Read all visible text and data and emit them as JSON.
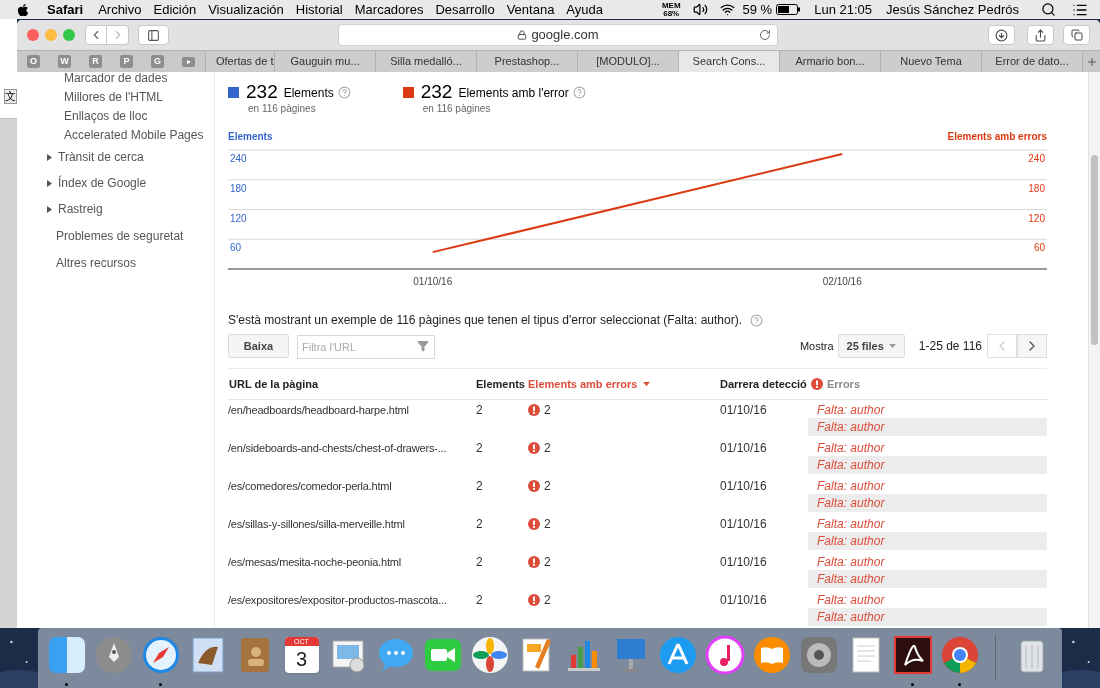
{
  "menu_bar": {
    "app": "Safari",
    "menus": [
      "Archivo",
      "Edición",
      "Visualización",
      "Historial",
      "Marcadores",
      "Desarrollo",
      "Ventana",
      "Ayuda"
    ],
    "memory": {
      "label": "MEM",
      "value": "68%"
    },
    "battery": "59 %",
    "clock": "Lun 21:05",
    "user": "Jesús Sánchez Pedrós"
  },
  "background_window": {
    "glyph": "文"
  },
  "browser": {
    "address": "google.com",
    "favorites": [
      "O",
      "W",
      "R",
      "P",
      "G"
    ],
    "tabs": [
      {
        "label": "Ofertas de t",
        "selected": false
      },
      {
        "label": "Gauguin mu...",
        "selected": false
      },
      {
        "label": "Silla medalló...",
        "selected": false
      },
      {
        "label": "Prestashop...",
        "selected": false
      },
      {
        "label": "[MODULO]...",
        "selected": false
      },
      {
        "label": "Search Cons...",
        "selected": true
      },
      {
        "label": "Armario bon...",
        "selected": false
      },
      {
        "label": "Nuevo Tema",
        "selected": false
      },
      {
        "label": "Error de dato...",
        "selected": false
      }
    ]
  },
  "sidebar": {
    "items": [
      {
        "kind": "sub",
        "label": "Marcador de dades"
      },
      {
        "kind": "sub",
        "label": "Millores de l'HTML"
      },
      {
        "kind": "sub",
        "label": "Enllaços de lloc"
      },
      {
        "kind": "sub",
        "label": "Accelerated Mobile Pages"
      },
      {
        "kind": "section",
        "label": "Trànsit de cerca",
        "expanded": false
      },
      {
        "kind": "section",
        "label": "Índex de Google",
        "expanded": false
      },
      {
        "kind": "section",
        "label": "Rastreig",
        "expanded": false
      },
      {
        "kind": "link",
        "label": "Problemes de seguretat"
      },
      {
        "kind": "link",
        "label": "Altres recursos"
      }
    ]
  },
  "summary": [
    {
      "value": "232",
      "label": "Elements",
      "note": "en 116 pàgines",
      "color": "#3366cc"
    },
    {
      "value": "232",
      "label": "Elements amb l'error",
      "note": "en 116 pàgines",
      "color": "#dc3912"
    }
  ],
  "chart": {
    "right_yticks": [
      "240",
      "180",
      "120",
      "60"
    ],
    "chart_data": {
      "type": "line",
      "ylabel": "Elements",
      "categories": [
        "01/10/16",
        "02/10/16"
      ],
      "series": [
        {
          "name": "Elements amb errors",
          "color": "#dc3912",
          "values": [
            34,
            232
          ]
        }
      ],
      "ylim": [
        0,
        240
      ],
      "grid": true,
      "yticks": [
        {
          "value": 60,
          "label": "60"
        },
        {
          "value": 120,
          "label": "120"
        },
        {
          "value": 180,
          "label": "180"
        },
        {
          "value": 240,
          "label": "240"
        }
      ]
    }
  },
  "sample_text": "S'està mostrant un exemple de 116 pàgines que tenen el tipus d'error seleccionat (Falta: author).",
  "controls": {
    "download_button": "Baixa",
    "filter": {
      "placeholder": "Filtra l'URL"
    },
    "show_label": "Mostra",
    "page_size": "25 files",
    "range": "1-25 de 116",
    "prev": {
      "disabled": true
    },
    "next": {
      "disabled": false
    }
  },
  "table": {
    "columns": [
      {
        "kind": "text",
        "label": "URL de la pàgina",
        "sorted": false
      },
      {
        "kind": "text",
        "label": "Elements",
        "sorted": false
      },
      {
        "kind": "text",
        "label": "Elements amb errors",
        "sorted": true
      },
      {
        "kind": "text",
        "label": "Darrera detecció",
        "sorted": false
      },
      {
        "kind": "errors",
        "label": "Errors",
        "sorted": false
      }
    ],
    "rows": [
      {
        "url": "/en/headboards/headboard-harpe.html",
        "elements": "2",
        "errors": "2",
        "detected": "01/10/16",
        "issues": [
          "Falta: author",
          "Falta: author"
        ]
      },
      {
        "url": "/en/sideboards-and-chests/chest-of-drawers-...",
        "elements": "2",
        "errors": "2",
        "detected": "01/10/16",
        "issues": [
          "Falta: author",
          "Falta: author"
        ]
      },
      {
        "url": "/es/comedores/comedor-perla.html",
        "elements": "2",
        "errors": "2",
        "detected": "01/10/16",
        "issues": [
          "Falta: author",
          "Falta: author"
        ]
      },
      {
        "url": "/es/sillas-y-sillones/silla-merveille.html",
        "elements": "2",
        "errors": "2",
        "detected": "01/10/16",
        "issues": [
          "Falta: author",
          "Falta: author"
        ]
      },
      {
        "url": "/es/mesas/mesita-noche-peonia.html",
        "elements": "2",
        "errors": "2",
        "detected": "01/10/16",
        "issues": [
          "Falta: author",
          "Falta: author"
        ]
      },
      {
        "url": "/es/expositores/expositor-productos-mascota...",
        "elements": "2",
        "errors": "2",
        "detected": "01/10/16",
        "issues": [
          "Falta: author",
          "Falta: author"
        ]
      }
    ]
  },
  "dock": [
    {
      "kind": "finder",
      "running": true
    },
    {
      "kind": "launchpad",
      "running": false
    },
    {
      "kind": "safari",
      "running": true
    },
    {
      "kind": "mail",
      "running": false
    },
    {
      "kind": "contacts",
      "running": false
    },
    {
      "kind": "calendar",
      "running": false,
      "month": "OCT",
      "day": "3"
    },
    {
      "kind": "viewer",
      "running": false
    },
    {
      "kind": "messages",
      "running": false
    },
    {
      "kind": "facetime",
      "running": false
    },
    {
      "kind": "photos",
      "running": false
    },
    {
      "kind": "pages",
      "running": false
    },
    {
      "kind": "numbers",
      "running": false
    },
    {
      "kind": "keynote",
      "running": false
    },
    {
      "kind": "appstore",
      "running": false
    },
    {
      "kind": "music",
      "running": false
    },
    {
      "kind": "books",
      "running": false
    },
    {
      "kind": "settings",
      "running": false
    },
    {
      "kind": "textedit",
      "running": false
    },
    {
      "kind": "acrobat",
      "running": true
    },
    {
      "kind": "chrome",
      "running": true
    },
    {
      "kind": "trash",
      "running": false
    }
  ]
}
